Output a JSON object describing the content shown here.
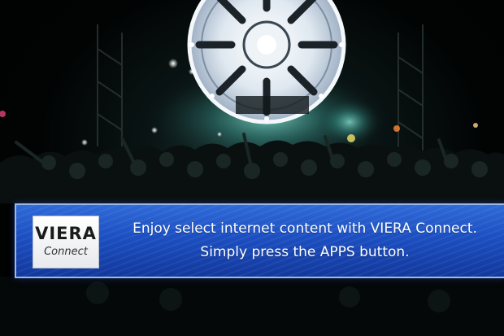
{
  "banner": {
    "logo": {
      "brand": "VIERA",
      "sub": "Connect"
    },
    "line1": "Enjoy select internet content with VIERA Connect.",
    "line2": "Simply press the APPS button."
  },
  "background": {
    "description_icon": "concert-stage-scene",
    "colors": {
      "haze": "#6fd6c9",
      "banner_top": "#2f6ad8",
      "banner_bottom": "#12389c",
      "banner_border": "#9ab8e8"
    }
  }
}
